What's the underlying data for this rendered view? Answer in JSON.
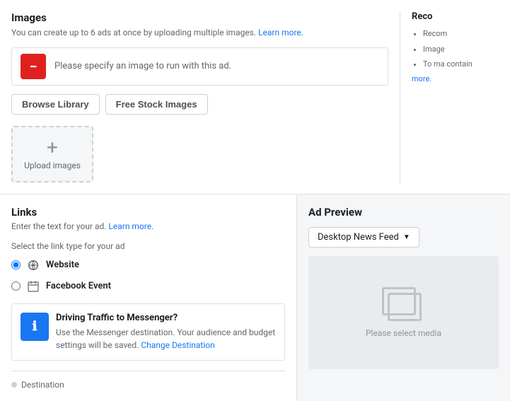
{
  "images_section": {
    "title": "Images",
    "description": "You can create up to 6 ads at once by uploading multiple images.",
    "learn_more": "Learn more.",
    "error_message": "Please specify an image to run with this ad.",
    "browse_library_label": "Browse Library",
    "free_stock_label": "Free Stock Images",
    "upload_label": "Upload images",
    "upload_plus": "+"
  },
  "recommendations": {
    "title": "Reco",
    "items": [
      "Recom",
      "Image",
      "To ma contain"
    ],
    "more_link": "more."
  },
  "links_section": {
    "title": "Links",
    "description": "Enter the text for your ad.",
    "learn_more": "Learn more.",
    "link_type_label": "Select the link type for your ad",
    "options": [
      {
        "id": "website",
        "label": "Website",
        "selected": true
      },
      {
        "id": "facebook_event",
        "label": "Facebook Event",
        "selected": false
      }
    ],
    "messenger_banner": {
      "title": "Driving Traffic to Messenger?",
      "description": "Use the Messenger destination. Your audience and budget settings will be saved.",
      "link_text": "Change Destination"
    },
    "destination_label": "Destination"
  },
  "ad_preview": {
    "title": "Ad Preview",
    "dropdown_label": "Desktop News Feed",
    "select_media_text": "Please select media"
  }
}
